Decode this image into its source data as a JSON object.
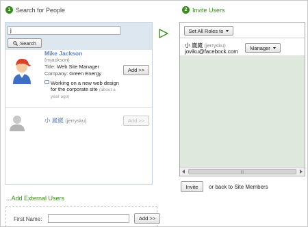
{
  "steps": {
    "left": {
      "num": "1",
      "label": "Search for People"
    },
    "right": {
      "num": "2",
      "label": "Invite Users"
    }
  },
  "search": {
    "value": "j",
    "button_label": "Search"
  },
  "results": [
    {
      "name": "Mike Jackson",
      "handle": "(mjackson)",
      "title_label": "Title:",
      "title": "Web Site Manager",
      "company_label": "Company:",
      "company": "Green Energy",
      "status": "Working on a new web design for the corporate site",
      "status_time": "(about a year ago)",
      "add_label": "Add >>"
    },
    {
      "name": "小 崴崴",
      "handle": "(jerrysku)",
      "add_label": "Add >>"
    }
  ],
  "invite": {
    "set_all_label": "Set All Roles to",
    "users": [
      {
        "name": "小 崴崴",
        "handle": "(jerrysku)",
        "email": "joviku@facebock.com",
        "role": "Manager"
      }
    ],
    "invite_button": "Invite",
    "back_prefix": "or back to",
    "back_link": "Site Members"
  },
  "external": {
    "heading": "...Add External Users",
    "first_name_label": "First Name:",
    "first_name_value": "",
    "add_label": "Add >>"
  },
  "colors": {
    "accent_green": "#3a8a20",
    "link_blue": "#5b84c4",
    "panel_blue": "#dde7f0",
    "invite_bg": "#dfe8dc"
  }
}
